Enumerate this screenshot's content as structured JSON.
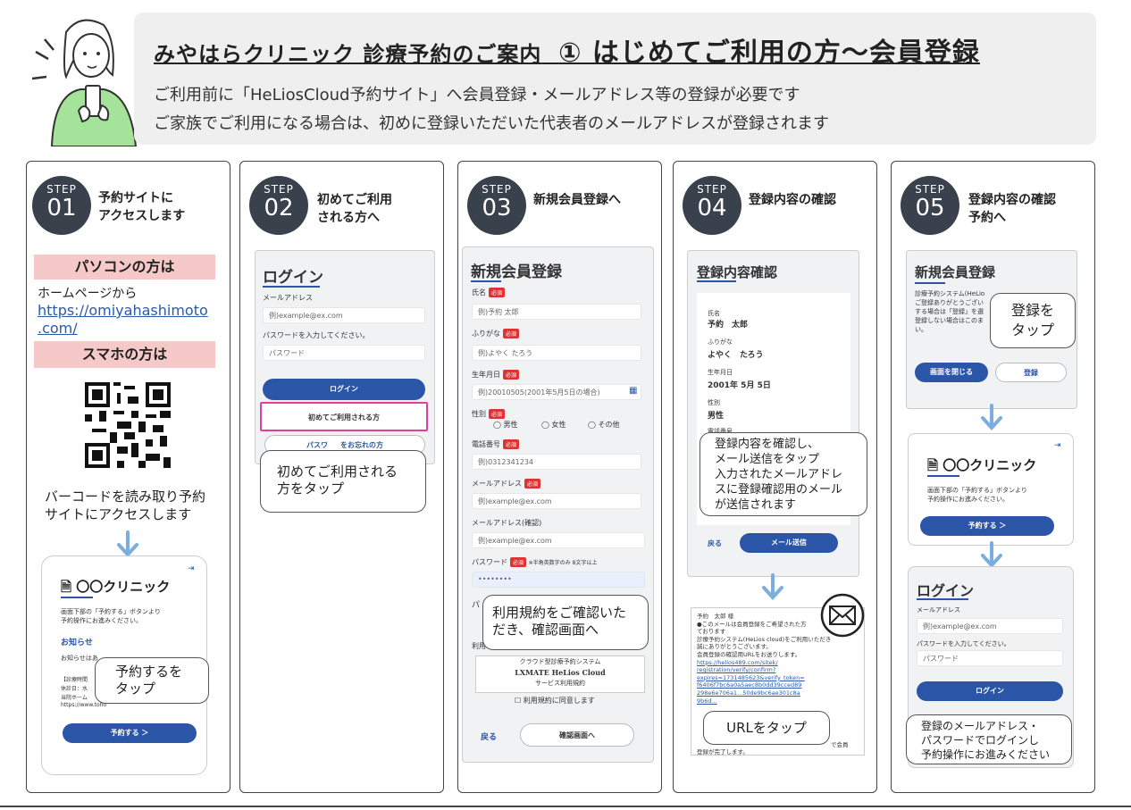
{
  "header": {
    "title_a": "みやはらクリニック 診療予約のご案内",
    "title_b": "① はじめてご利用の方～会員登録",
    "line1": "ご利用前に「HeLiosCloud予約サイト」へ会員登録・メールアドレス等の登録が必要です",
    "line2": "ご家族でご利用になる場合は、初めに登録いただいた代表者のメールアドレスが登録されます"
  },
  "steps": [
    {
      "label": "STEP",
      "num": "01",
      "title": "予約サイトに\nアクセスします"
    },
    {
      "label": "STEP",
      "num": "02",
      "title": "初めてご利用\nされる方へ"
    },
    {
      "label": "STEP",
      "num": "03",
      "title": "新規会員登録へ"
    },
    {
      "label": "STEP",
      "num": "04",
      "title": "登録内容の確認"
    },
    {
      "label": "STEP",
      "num": "05",
      "title": "登録内容の確認\n予約へ"
    }
  ],
  "step1": {
    "pc_head": "パソコンの方は",
    "pc_text": "ホームページから",
    "url1": "https://omiyahashimoto",
    "url2": ".com/",
    "sp_head": "スマホの方は",
    "qr_text": "バーコードを読み取り予約\nサイトにアクセスします",
    "clinic": "〇〇クリニック",
    "desc": "画面下部の「予約する」ボタンより\n予約操作にお進みください。",
    "notice": "お知らせ",
    "notice_text": "お知らせはあ",
    "small1": "【診療時間",
    "small2": "休診日：水",
    "small3": "当院ホーム",
    "small4": "https://www.toho",
    "reserve_btn": "予約する ＞",
    "bubble": "予約するを\nタップ"
  },
  "step2": {
    "login": "ログイン",
    "mail_label": "メールアドレス",
    "mail_ph": "例)example@ex.com",
    "pw_label": "パスワードを入力してください。",
    "pw_ph": "パスワード",
    "login_btn": "ログイン",
    "first_btn": "初めてご利用される方",
    "forgot_a": "パスワ",
    "forgot_b": "をお忘れの方",
    "bubble": "初めてご利用される\n方をタップ"
  },
  "step3": {
    "title": "新規会員登録",
    "name_l": "氏名",
    "name_v": "例)予約 太郎",
    "kana_l": "ふりがな",
    "kana_v": "例)よやく たろう",
    "birth_l": "生年月日",
    "birth_v": "例)20010505(2001年5月5日の場合)",
    "sex_l": "性別",
    "male": "男性",
    "female": "女性",
    "other": "その他",
    "tel_l": "電話番号",
    "tel_v": "例)0312341234",
    "mail_l": "メールアドレス",
    "mail_v": "例)example@ex.com",
    "mail2_l": "メールアドレス(確認)",
    "mail2_v": "例)example@ex.com",
    "pw_l": "パスワード",
    "pw_note": "※半角英数字のみ 8文字以上",
    "pw_v": "••••••••",
    "pa": "パ",
    "ri": "利用",
    "req": "必須",
    "terms1": "クラウド型診療予約システム",
    "terms2": "LXMATE HeLios Cloud",
    "terms3": "サービス利用規約",
    "agree": "利用規約に同意します",
    "back": "戻る",
    "confirm_btn": "確認画面へ",
    "bubble": "利用規約をご確認いた\nだき、確認画面へ"
  },
  "step4": {
    "title": "登録内容確認",
    "name_l": "氏名",
    "name_v": "予約　太郎",
    "kana_l": "ふりがな",
    "kana_v": "よやく　たろう",
    "birth_l": "生年月日",
    "birth_v": "2001年 5月 5日",
    "sex_l": "性別",
    "sex_v": "男性",
    "tel_l": "電話番号",
    "back": "戻る",
    "send_btn": "メール送信",
    "bubble": "登録内容を確認し、\nメール送信をタップ\n入力されたメールアドレ\nスに登録確認用のメール\nが送信されます",
    "mail_lines": [
      "予約　太郎 様",
      "●このメールは会員登録をご希望された方",
      "ております",
      "診療予約システム(HeLios cloud)をご利用いただき",
      "誠にありがとうございます。",
      "会員登録の確認用URLをお送りします。"
    ],
    "mail_links": [
      "https://helios489.com/sitek/",
      "registration/verify/confirm?",
      "expires=1731485623&verify_token=",
      "f6406f7bc6a0a5aec8b0dd39cced89",
      "298e6e706a1...50de9bc6ae301c8a",
      "9b6d..."
    ],
    "mail_tail1": "で会員",
    "mail_tail2": "登録が完了します。",
    "bubble2": "URLをタップ"
  },
  "step5": {
    "title": "新規会員登録",
    "p1": "診療予約システム(HeLio",
    "p2": "ご登録ありがとうござい",
    "p3": "する場合は「登録」を選",
    "p4": "登録しない場合はこのま",
    "p5": "い。",
    "close_btn": "画面を閉じる",
    "reg_btn": "登録",
    "bubble1": "登録を\nタップ",
    "clinic": "〇〇クリニック",
    "desc": "画面下部の「予約する」ボタンより\n予約操作にお進みください。",
    "reserve_btn": "予約する ＞",
    "login": "ログイン",
    "mail_label": "メールアドレス",
    "mail_ph": "例)example@ex.com",
    "pw_label": "パスワードを入力してください。",
    "pw_ph": "パスワード",
    "login_btn": "ログイン",
    "bubble2": "登録のメールアドレス・\nパスワードでログインし\n予約操作にお進みください"
  },
  "colors": {
    "accent": "#2b56a8",
    "badge": "#39414c",
    "pink": "#f6c9c9",
    "arrow": "#7aaee0",
    "highlight": "#e0409a"
  }
}
